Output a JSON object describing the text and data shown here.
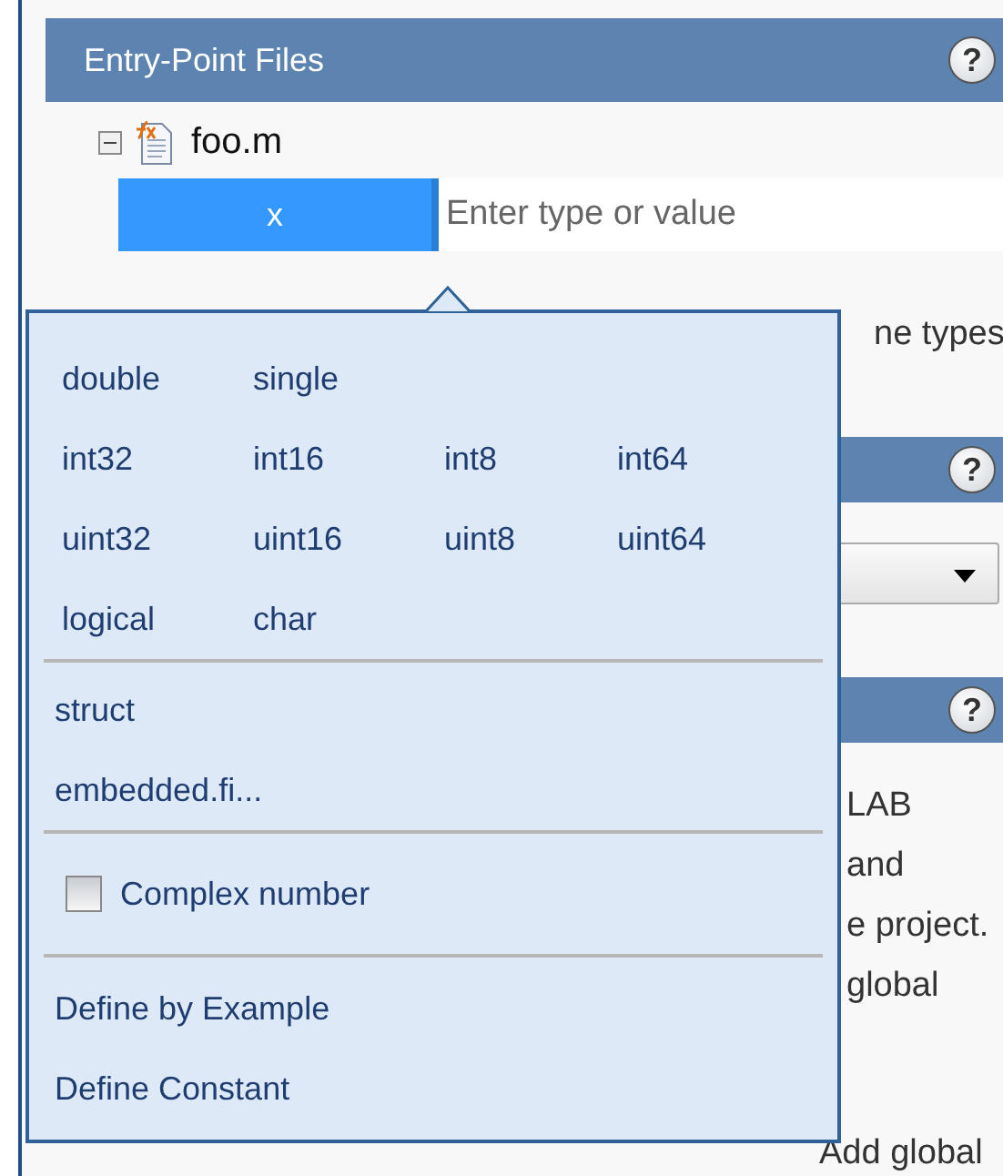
{
  "panel": {
    "title": "Entry-Point Files",
    "help": "?"
  },
  "background_sections": [
    {
      "help": "?"
    },
    {
      "help": "?"
    }
  ],
  "file": {
    "name": "foo.m",
    "expanded": true
  },
  "inputs": [
    {
      "name": "x",
      "selected": true,
      "placeholder": "Enter type or value"
    }
  ],
  "type_menu": {
    "type_rows": [
      [
        "double",
        "single"
      ],
      [
        "int32",
        "int16",
        "int8",
        "int64"
      ],
      [
        "uint32",
        "uint16",
        "uint8",
        "uint64"
      ],
      [
        "logical",
        "char"
      ]
    ],
    "other_types": [
      "struct",
      "embedded.fi..."
    ],
    "complex": {
      "label": "Complex number",
      "checked": false
    },
    "actions": [
      "Define by Example",
      "Define Constant"
    ]
  },
  "background": {
    "link_fragment": "ne types",
    "text_fragments": [
      "LAB",
      "and",
      "e project.",
      "global"
    ],
    "add_link": "Add global"
  }
}
